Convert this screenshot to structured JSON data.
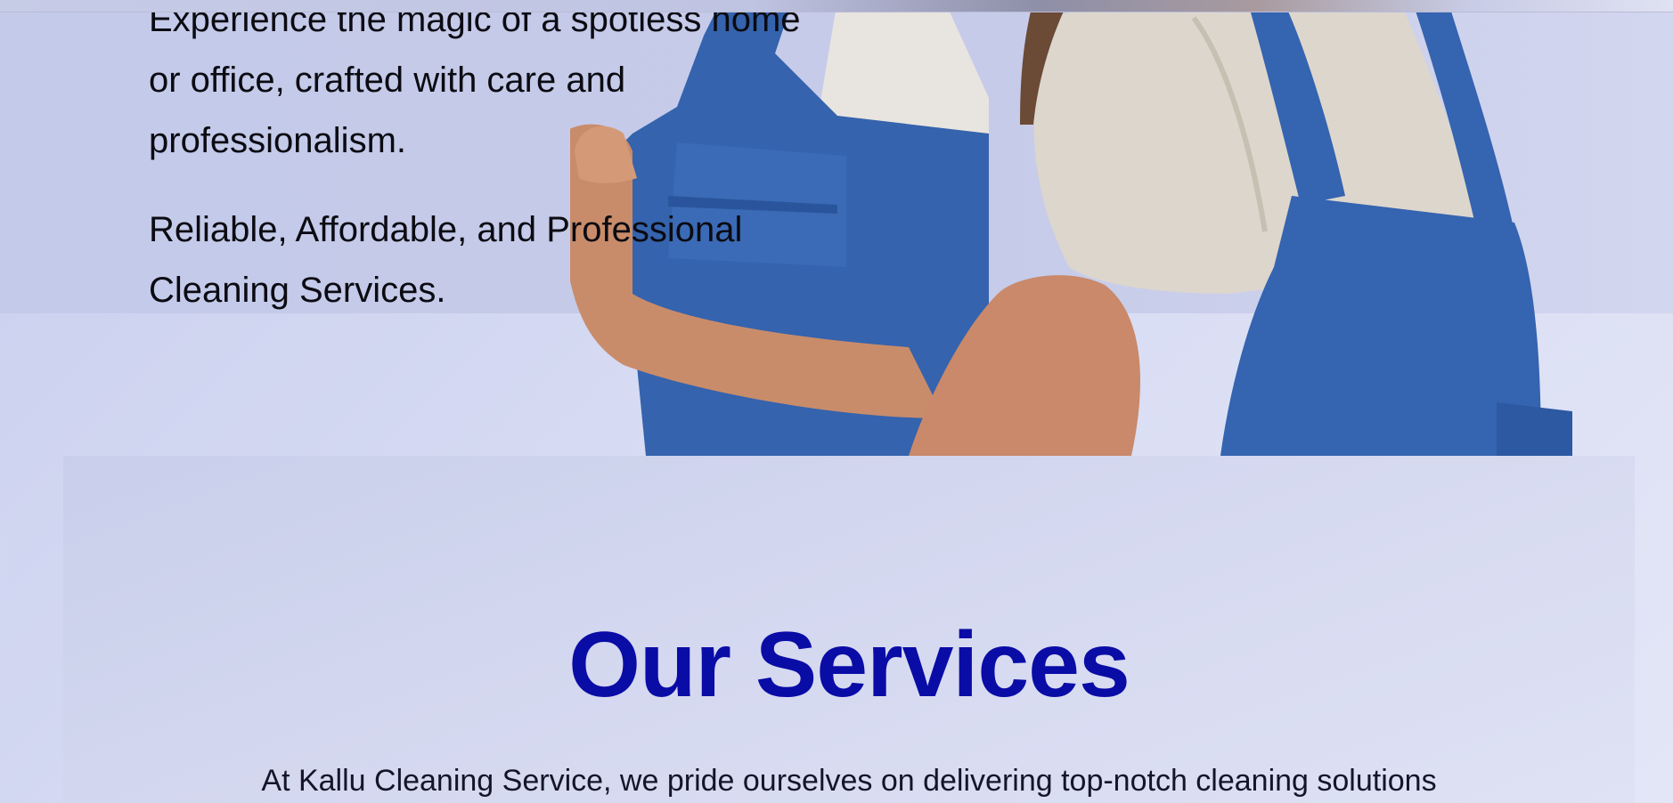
{
  "hero": {
    "description_line_1": "Experience the magic of a spotless home",
    "description_line_2": "or office, crafted with care and",
    "description_line_3": "professionalism.",
    "tagline_line_1": "Reliable, Affordable, and Professional",
    "tagline_line_2": "Cleaning Services.",
    "image_icon": "cleaners-in-blue-aprons-photo"
  },
  "services": {
    "heading": "Our Services",
    "intro": "At Kallu Cleaning Service, we pride ourselves on delivering top-notch cleaning solutions"
  },
  "colors": {
    "heading_blue": "#0a0ca6",
    "apron_blue": "#2f5fae",
    "background_lavender": "#c9cfee"
  }
}
